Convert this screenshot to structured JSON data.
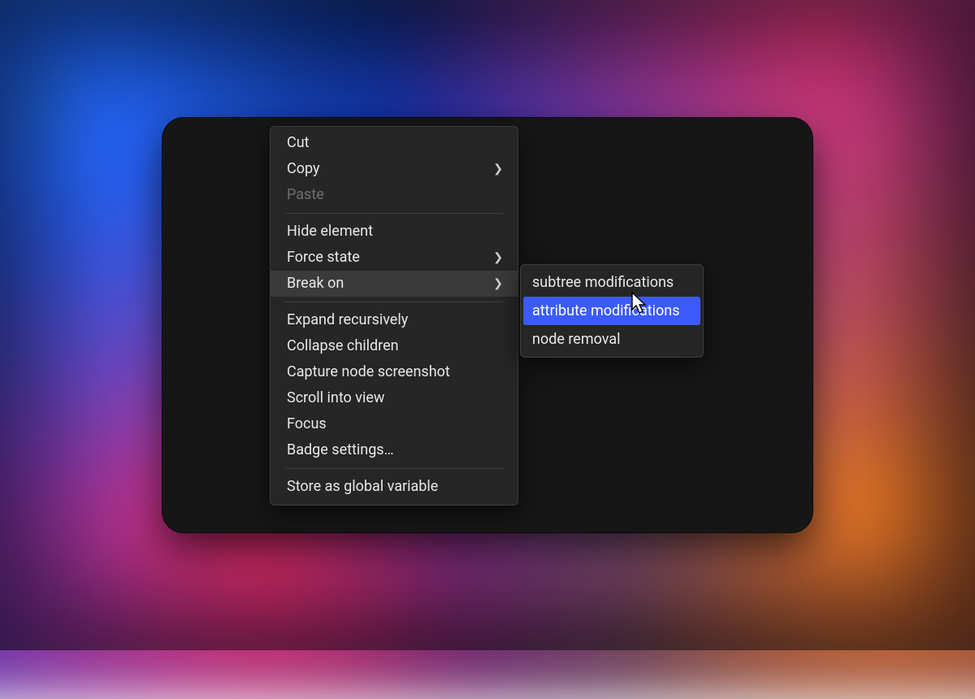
{
  "colors": {
    "panel_bg": "#161616",
    "menu_bg": "#262626",
    "menu_border": "#3d3d3d",
    "menu_text": "#e8e8e8",
    "menu_disabled": "#6e6e6e",
    "menu_hover_bg": "#3a3a3a",
    "submenu_selected_bg": "#3b5bff",
    "submenu_selected_text": "#ffffff"
  },
  "context_menu": {
    "groups": [
      {
        "items": [
          {
            "id": "cut",
            "label": "Cut"
          },
          {
            "id": "copy",
            "label": "Copy",
            "has_submenu": true
          },
          {
            "id": "paste",
            "label": "Paste",
            "disabled": true
          }
        ]
      },
      {
        "items": [
          {
            "id": "hide-element",
            "label": "Hide element"
          },
          {
            "id": "force-state",
            "label": "Force state",
            "has_submenu": true
          },
          {
            "id": "break-on",
            "label": "Break on",
            "has_submenu": true,
            "hovered": true
          }
        ]
      },
      {
        "items": [
          {
            "id": "expand-recursively",
            "label": "Expand recursively"
          },
          {
            "id": "collapse-children",
            "label": "Collapse children"
          },
          {
            "id": "capture-node-screenshot",
            "label": "Capture node screenshot"
          },
          {
            "id": "scroll-into-view",
            "label": "Scroll into view"
          },
          {
            "id": "focus",
            "label": "Focus"
          },
          {
            "id": "badge-settings",
            "label": "Badge settings…"
          }
        ]
      },
      {
        "items": [
          {
            "id": "store-as-global",
            "label": "Store as global variable"
          }
        ]
      }
    ]
  },
  "submenu": {
    "parent": "break-on",
    "items": [
      {
        "id": "subtree-modifications",
        "label": "subtree modifications"
      },
      {
        "id": "attribute-modifications",
        "label": "attribute modifications",
        "selected": true
      },
      {
        "id": "node-removal",
        "label": "node removal"
      }
    ]
  }
}
